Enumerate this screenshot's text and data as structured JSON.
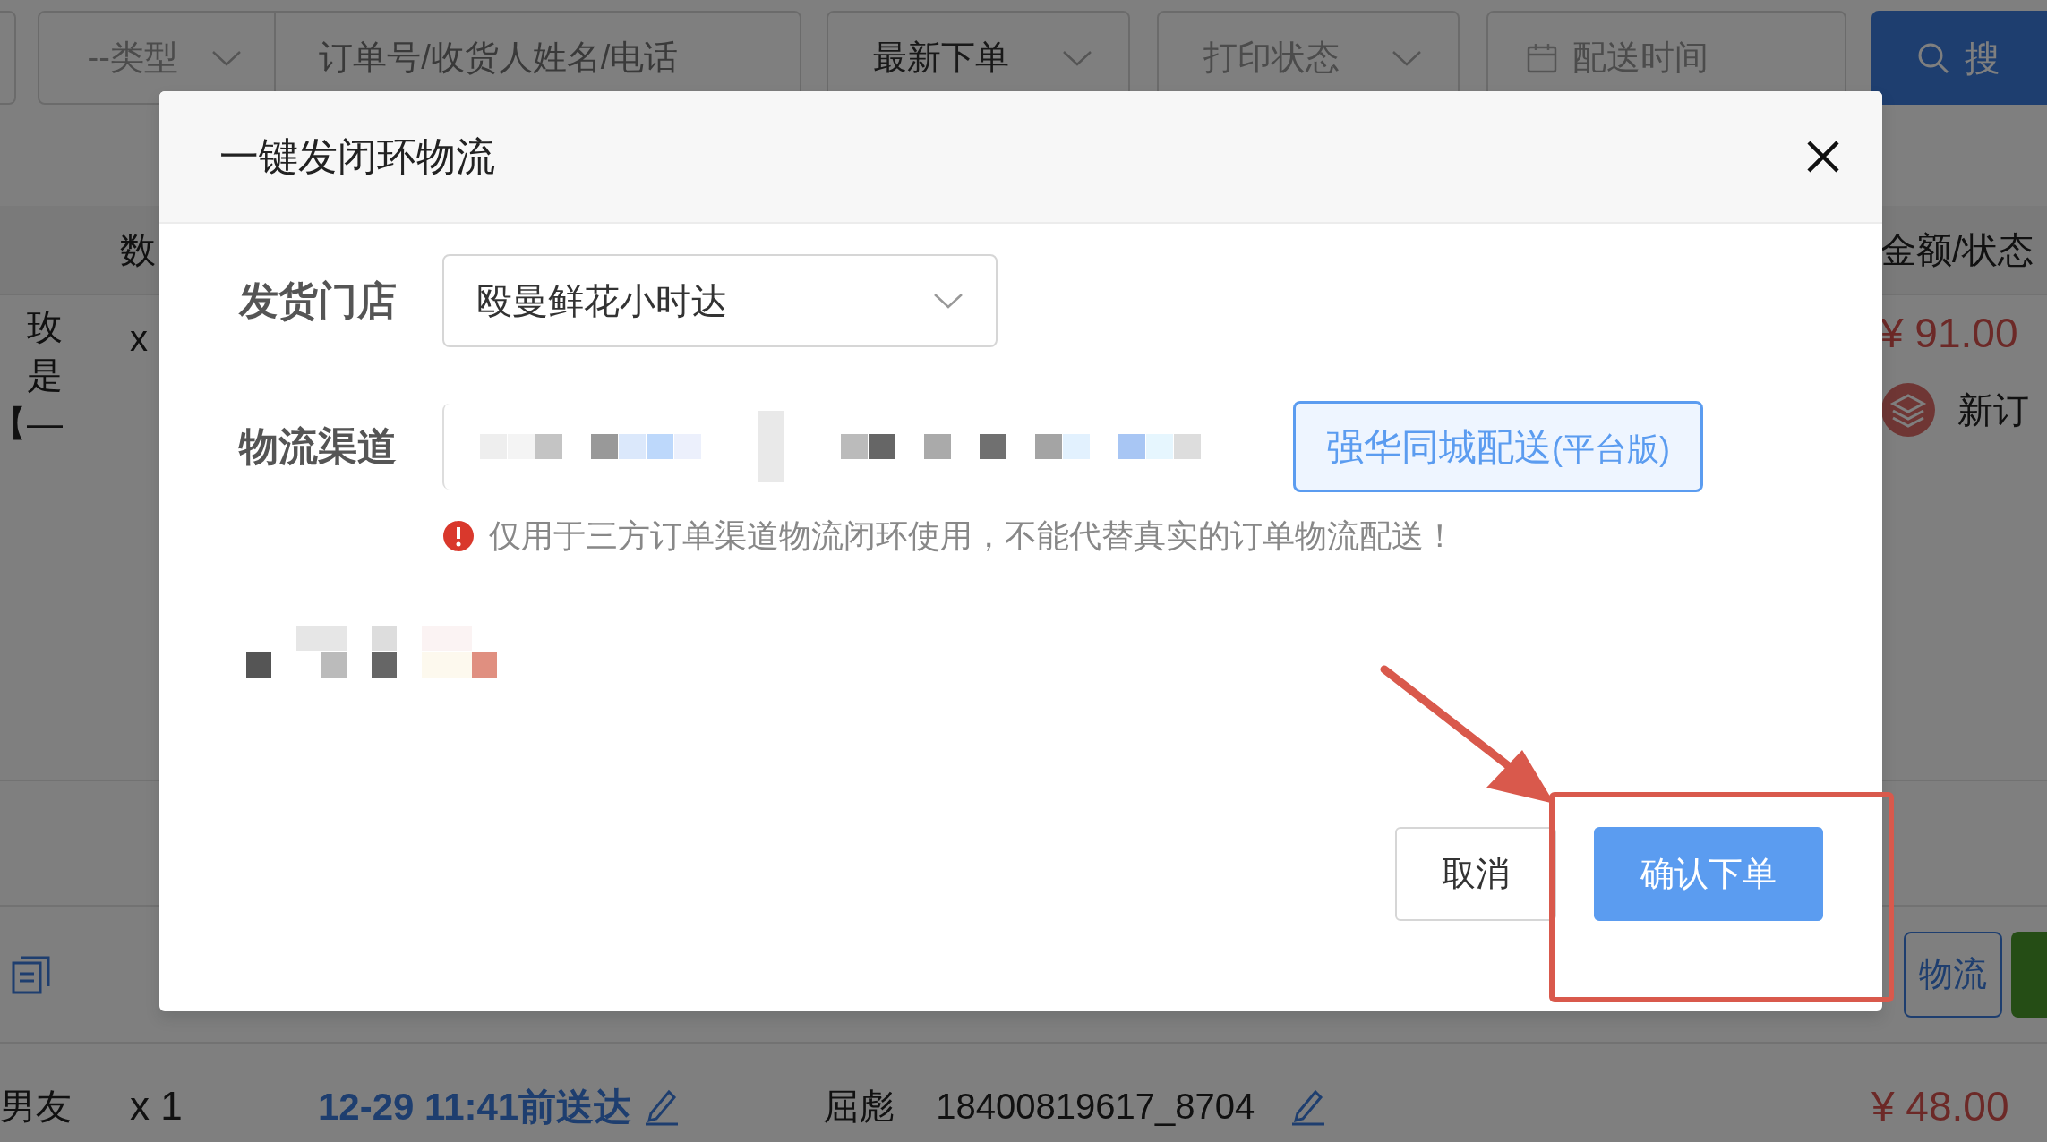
{
  "filters": {
    "type_select": {
      "value": "--类型"
    },
    "search_field": {
      "placeholder": "订单号/收货人姓名/电话"
    },
    "sort_select": {
      "value": "最新下单"
    },
    "print_select": {
      "placeholder": "打印状态"
    },
    "date_field": {
      "placeholder": "配送时间"
    },
    "search_button": "搜"
  },
  "table": {
    "columns": [
      "数",
      "金额/状态"
    ],
    "rows": [
      {
        "product_lines": [
          "玫",
          "是",
          "【—"
        ],
        "quantity": "x",
        "amount": "¥ 91.00",
        "status": "新订",
        "logistics_button": "物流"
      },
      {
        "product_lines": [
          "男友"
        ],
        "quantity": "x 1",
        "delivery_time": "12-29 11:41前送达",
        "recipient": "屈彪",
        "phone": "18400819617_8704",
        "amount": "¥ 48.00"
      }
    ]
  },
  "dialog": {
    "title": "一键发闭环物流",
    "fields": [
      {
        "label": "发货门店",
        "kind": "select",
        "value": "殴曼鲜花小时达"
      },
      {
        "label": "物流渠道",
        "kind": "channel",
        "option": {
          "name": "强华同城配送",
          "suffix": "(平台版)",
          "selected": true
        }
      }
    ],
    "warning": "仅用于三方订单渠道物流闭环使用，不能代替真实的订单物流配送！",
    "buttons": [
      {
        "label": "取消",
        "kind": "secondary"
      },
      {
        "label": "确认下单",
        "kind": "primary"
      }
    ]
  }
}
